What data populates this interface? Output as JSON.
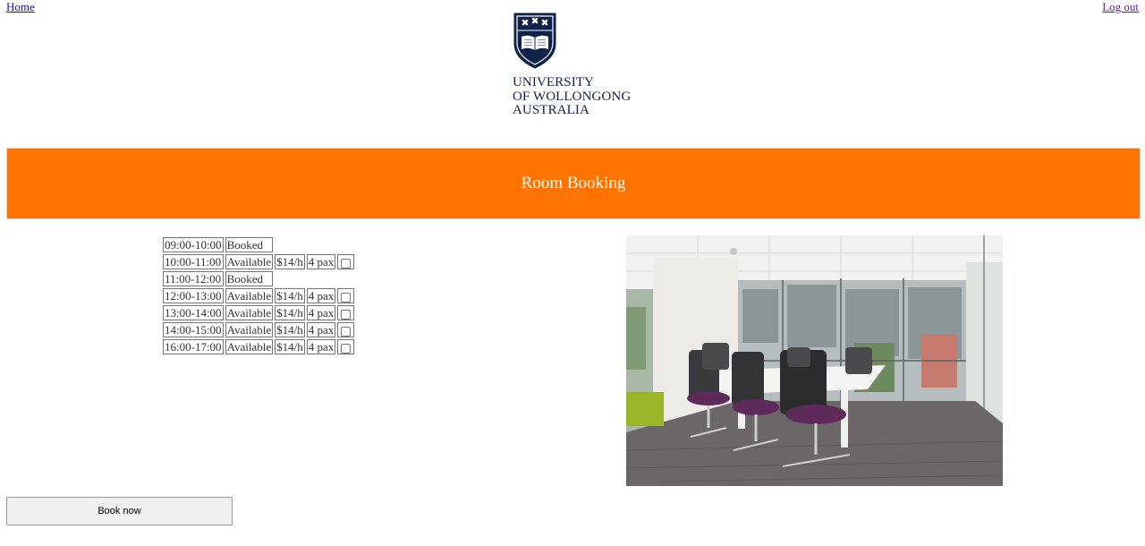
{
  "nav": {
    "home_label": "Home",
    "logout_label": "Log out"
  },
  "logo": {
    "line1": "UNIVERSITY",
    "line2": "OF WOLLONGONG",
    "line3": "AUSTRALIA"
  },
  "banner": {
    "title": "Room Booking",
    "color": "#ff7300"
  },
  "slots": [
    {
      "time": "09:00-10:00",
      "status": "Booked"
    },
    {
      "time": "10:00-11:00",
      "status": "Available",
      "price": "$14/h",
      "capacity": "4 pax",
      "checked": false
    },
    {
      "time": "11:00-12:00",
      "status": "Booked"
    },
    {
      "time": "12:00-13:00",
      "status": "Available",
      "price": "$14/h",
      "capacity": "4 pax",
      "checked": false
    },
    {
      "time": "13:00-14:00",
      "status": "Available",
      "price": "$14/h",
      "capacity": "4 pax",
      "checked": false
    },
    {
      "time": "14:00-15:00",
      "status": "Available",
      "price": "$14/h",
      "capacity": "4 pax",
      "checked": false
    },
    {
      "time": "16:00-17:00",
      "status": "Available",
      "price": "$14/h",
      "capacity": "4 pax",
      "checked": false
    }
  ],
  "book_button_label": "Book now"
}
